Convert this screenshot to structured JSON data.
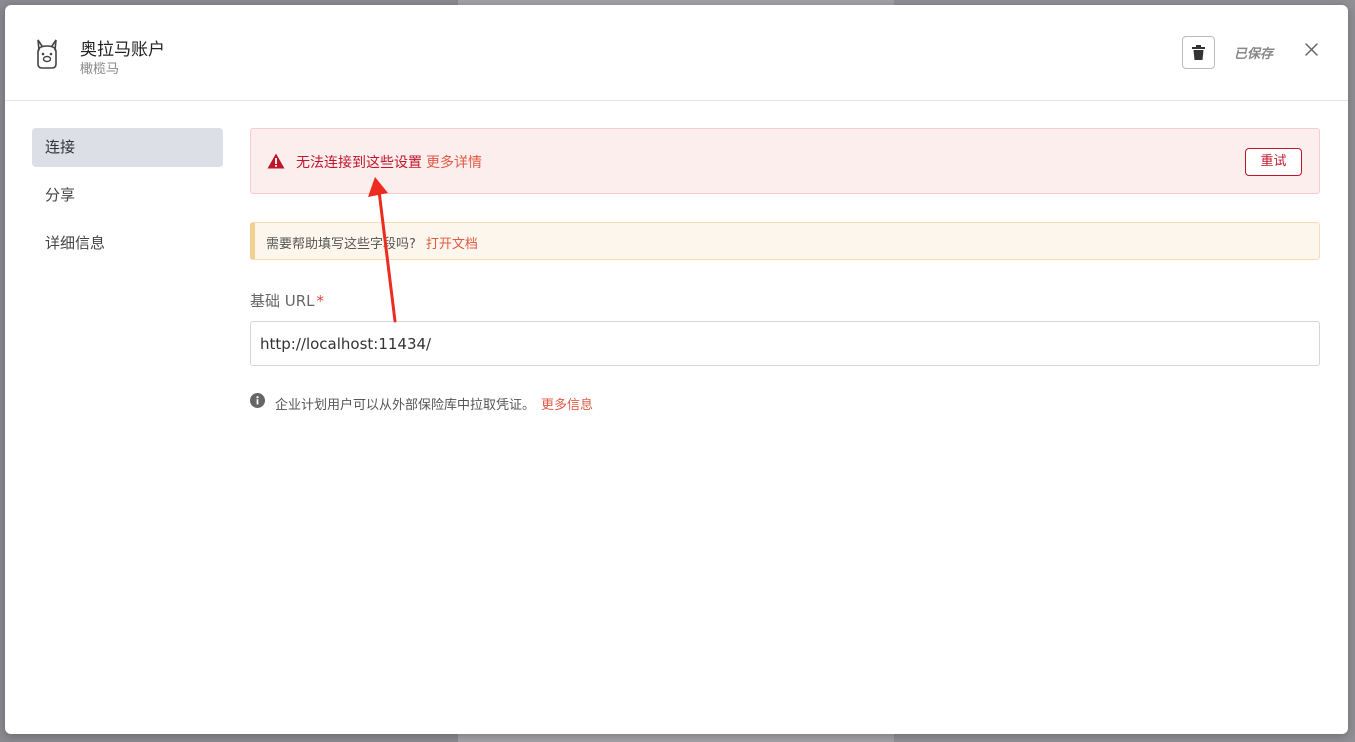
{
  "header": {
    "title": "奥拉马账户",
    "subtitle": "橄榄马",
    "saved_label": "已保存",
    "logo_icon": "llama-icon",
    "delete_icon": "trash-icon",
    "close_icon": "close-icon"
  },
  "sidebar": {
    "items": [
      {
        "label": "连接",
        "active": true
      },
      {
        "label": "分享",
        "active": false
      },
      {
        "label": "详细信息",
        "active": false
      }
    ]
  },
  "alert": {
    "icon": "warning-triangle-icon",
    "message": "无法连接到这些设置",
    "link": "更多详情",
    "retry_label": "重试",
    "color": "#c0162b"
  },
  "help": {
    "text": "需要帮助填写这些字段吗?",
    "link": "打开文档"
  },
  "form": {
    "base_url_label": "基础 URL",
    "required_marker": "*",
    "base_url_value": "http://localhost:11434/"
  },
  "info": {
    "icon": "info-circle-icon",
    "text": "企业计划用户可以从外部保险库中拉取凭证。",
    "link": "更多信息"
  },
  "colors": {
    "accent": "#e05a45",
    "annotation_arrow": "#ee2b1f"
  }
}
